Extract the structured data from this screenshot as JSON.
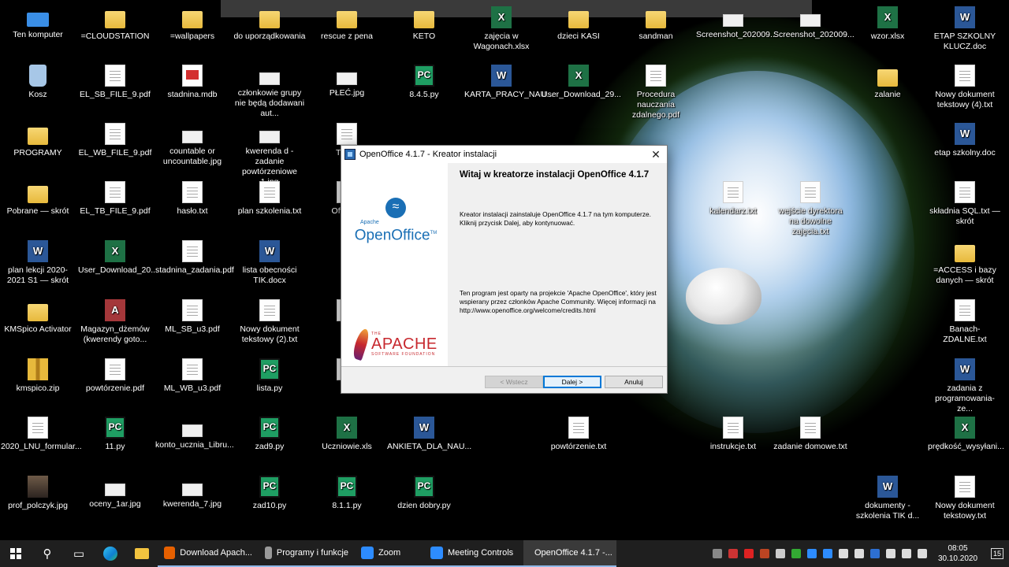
{
  "desktop": {
    "icons": [
      {
        "label": "Ten komputer",
        "type": "pc-monitor"
      },
      {
        "label": "=CLOUDSTATION",
        "type": "folder"
      },
      {
        "label": "=wallpapers",
        "type": "folder"
      },
      {
        "label": "do uporządkowania",
        "type": "folder"
      },
      {
        "label": "rescue z pena",
        "type": "folder"
      },
      {
        "label": "KETO",
        "type": "folder"
      },
      {
        "label": "zajęcia w Wagonach.xlsx",
        "type": "excel"
      },
      {
        "label": "dzieci KASI",
        "type": "folder"
      },
      {
        "label": "sandman",
        "type": "folder"
      },
      {
        "label": "Screenshot_202009...",
        "type": "img"
      },
      {
        "label": "Screenshot_202009...",
        "type": "img"
      },
      {
        "label": "wzor.xlsx",
        "type": "excel"
      },
      {
        "label": "ETAP SZKOLNY KLUCZ.doc",
        "type": "word"
      },
      {
        "label": "Kosz",
        "type": "recycle"
      },
      {
        "label": "EL_SB_FILE_9.pdf",
        "type": "doc"
      },
      {
        "label": "stadnina.mdb",
        "type": "pdf"
      },
      {
        "label": "członkowie grupy nie będą dodawani aut...",
        "type": "img"
      },
      {
        "label": "PŁEĆ.jpg",
        "type": "img"
      },
      {
        "label": "8.4.5.py",
        "type": "pc"
      },
      {
        "label": "KARTA_PRACY_NAU...",
        "type": "word"
      },
      {
        "label": "User_Download_29...",
        "type": "excel"
      },
      {
        "label": "Procedura nauczania zdalnego.pdf",
        "type": "doc"
      },
      {
        "label": "zalanie",
        "type": "folder"
      },
      {
        "label": "Nowy dokument tekstowy (4).txt",
        "type": "doc"
      },
      {
        "label": "PROGRAMY",
        "type": "folder"
      },
      {
        "label": "EL_WB_FILE_9.pdf",
        "type": "doc"
      },
      {
        "label": "countable or uncountable.jpg",
        "type": "img"
      },
      {
        "label": "kwerenda d - zadanie powtórzeniowe 1.jpg",
        "type": "img"
      },
      {
        "label": "TB 2a",
        "type": "doc"
      },
      {
        "label": "etap szkolny.doc",
        "type": "word"
      },
      {
        "label": "Pobrane — skrót",
        "type": "folder"
      },
      {
        "label": "EL_TB_FILE_9.pdf",
        "type": "doc"
      },
      {
        "label": "hasło.txt",
        "type": "doc"
      },
      {
        "label": "plan szkolenia.txt",
        "type": "doc"
      },
      {
        "label": "Office_2",
        "type": "doc"
      },
      {
        "label": "kalendarz.txt",
        "type": "doc"
      },
      {
        "label": "wejście dyrektora na dowolne zajęcia.txt",
        "type": "doc"
      },
      {
        "label": "składnia SQL.txt — skrót",
        "type": "doc"
      },
      {
        "label": "plan lekcji 2020-2021 S1 — skrót",
        "type": "word"
      },
      {
        "label": "User_Download_20...",
        "type": "excel"
      },
      {
        "label": "stadnina_zadania.pdf",
        "type": "doc"
      },
      {
        "label": "lista obecności TIK.docx",
        "type": "word"
      },
      {
        "label": "=ACCESS i bazy danych — skrót",
        "type": "folder"
      },
      {
        "label": "KMSpico Activator",
        "type": "folder"
      },
      {
        "label": "Magazyn_dżemów (kwerendy goto...",
        "type": "access"
      },
      {
        "label": "ML_SB_u3.pdf",
        "type": "doc"
      },
      {
        "label": "Nowy dokument tekstowy (2).txt",
        "type": "doc"
      },
      {
        "label": "Fi",
        "type": "doc"
      },
      {
        "label": "Banach-ZDALNE.txt",
        "type": "doc"
      },
      {
        "label": "kmspico.zip",
        "type": "zip"
      },
      {
        "label": "powtórzenie.pdf",
        "type": "doc"
      },
      {
        "label": "ML_WB_u3.pdf",
        "type": "doc"
      },
      {
        "label": "lista.py",
        "type": "pc"
      },
      {
        "label": "Kli",
        "type": "doc"
      },
      {
        "label": "zadania z programowania-ze...",
        "type": "word"
      },
      {
        "label": "2020_LNU_formular...",
        "type": "doc"
      },
      {
        "label": "11.py",
        "type": "pc"
      },
      {
        "label": "konto_ucznia_Libru...",
        "type": "img"
      },
      {
        "label": "zad9.py",
        "type": "pc"
      },
      {
        "label": "Uczniowie.xls",
        "type": "excel"
      },
      {
        "label": "ANKIETA_DLA_NAU...",
        "type": "word"
      },
      {
        "label": "powtórzenie.txt",
        "type": "doc"
      },
      {
        "label": "instrukcje.txt",
        "type": "doc"
      },
      {
        "label": "zadanie domowe.txt",
        "type": "doc"
      },
      {
        "label": "prędkość_wysyłani...",
        "type": "excel"
      },
      {
        "label": "prof_polczyk.jpg",
        "type": "photo"
      },
      {
        "label": "oceny_1ar.jpg",
        "type": "img"
      },
      {
        "label": "kwerenda_7.jpg",
        "type": "img"
      },
      {
        "label": "zad10.py",
        "type": "pc"
      },
      {
        "label": "8.1.1.py",
        "type": "pc"
      },
      {
        "label": "dzien dobry.py",
        "type": "pc"
      },
      {
        "label": "dokumenty - szkolenia TIK d...",
        "type": "word"
      },
      {
        "label": "Nowy dokument tekstowy.txt",
        "type": "doc"
      }
    ]
  },
  "dialog": {
    "title": "OpenOffice 4.1.7 - Kreator instalacji",
    "close_glyph": "✕",
    "heading": "Witaj w kreatorze instalacji OpenOffice 4.1.7",
    "paragraph1": "Kreator instalacji zainstaluje OpenOffice 4.1.7 na tym komputerze. Kliknij przycisk Dalej, aby kontynuować.",
    "paragraph2": "Ten program jest oparty na projekcie 'Apache OpenOffice', który jest wspierany przez członków Apache Community. Więcej informacji na http://www.openoffice.org/welcome/credits.html",
    "logo_oo_small": "Apache",
    "logo_oo_big": "OpenOffice",
    "logo_oo_tm": "TM",
    "logo_apache": "APACHE",
    "logo_apache_sub": "SOFTWARE FOUNDATION",
    "logo_apache_the": "THE",
    "buttons": {
      "back": "< Wstecz",
      "next": "Dalej >",
      "cancel": "Anuluj"
    }
  },
  "taskbar": {
    "items": [
      {
        "label": "Download Apach...",
        "color": "#e66000",
        "state": "running"
      },
      {
        "label": "Programy i funkcje",
        "color": "#9a9a9a",
        "state": "running"
      },
      {
        "label": "Zoom",
        "color": "#2d8cff",
        "state": "running"
      },
      {
        "label": "Meeting Controls",
        "color": "#2d8cff",
        "state": "running"
      },
      {
        "label": "OpenOffice 4.1.7 -...",
        "color": "#2b6ab0",
        "state": "active"
      }
    ],
    "time": "08:05",
    "date": "30.10.2020",
    "notifications": "15"
  }
}
